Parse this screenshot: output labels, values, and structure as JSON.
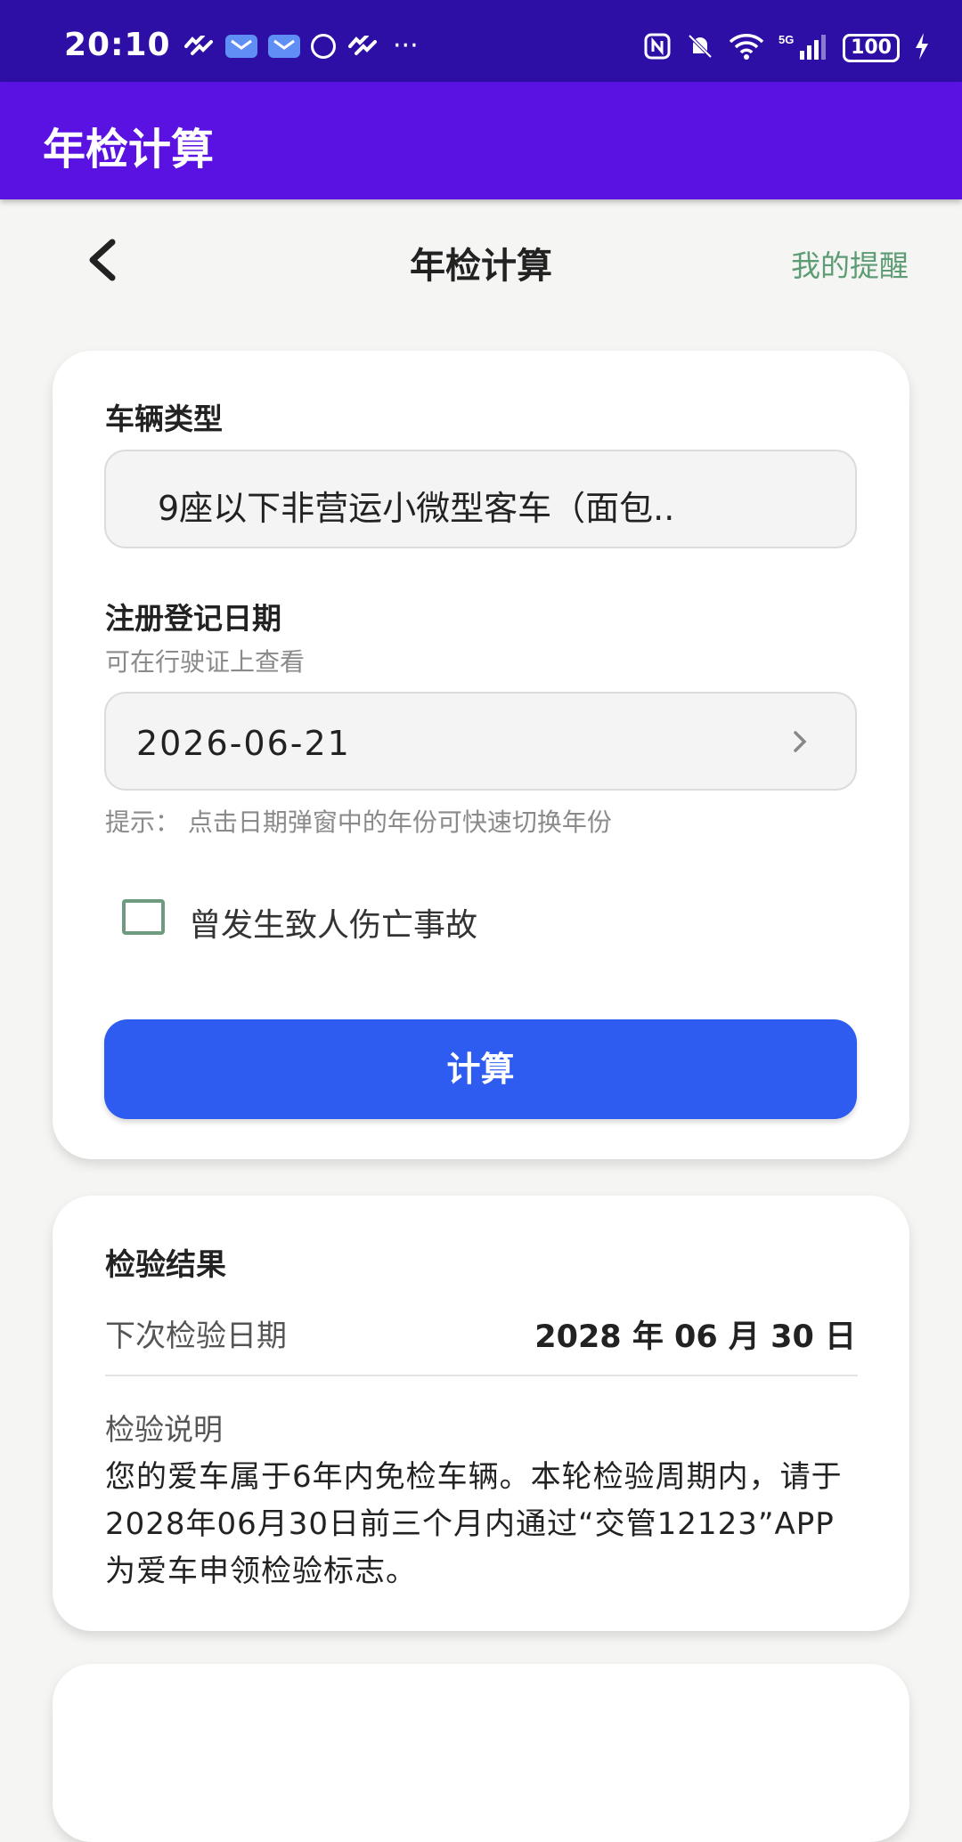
{
  "status_bar": {
    "time": "20:10",
    "more": "···",
    "battery": "100",
    "network": "5G"
  },
  "app_bar": {
    "title": "年检计算"
  },
  "header": {
    "title": "年检计算",
    "reminder_link": "我的提醒"
  },
  "form": {
    "vehicle_type_label": "车辆类型",
    "vehicle_type_value": "9座以下非营运小微型客车（面包..",
    "reg_date_label": "注册登记日期",
    "reg_date_hint": "可在行驶证上查看",
    "reg_date_value": "2026-06-21",
    "tip": "提示：  点击日期弹窗中的年份可快速切换年份",
    "accident_checkbox_label": "曾发生致人伤亡事故",
    "accident_checked": false,
    "calculate_button": "计算"
  },
  "result": {
    "title": "检验结果",
    "next_date_label": "下次检验日期",
    "next_date_value": "2028 年 06 月 30 日",
    "explain_label": "检验说明",
    "explain_text": "您的爱车属于6年内免检车辆。本轮检验周期内，请于2028年06月30日前三个月内通过“交管12123”APP为爱车申领检验标志。"
  },
  "colors": {
    "status_bar": "#2e0fa6",
    "app_bar": "#5a12e3",
    "accent_green": "#5d9c74",
    "button_blue": "#2e5cf0"
  }
}
